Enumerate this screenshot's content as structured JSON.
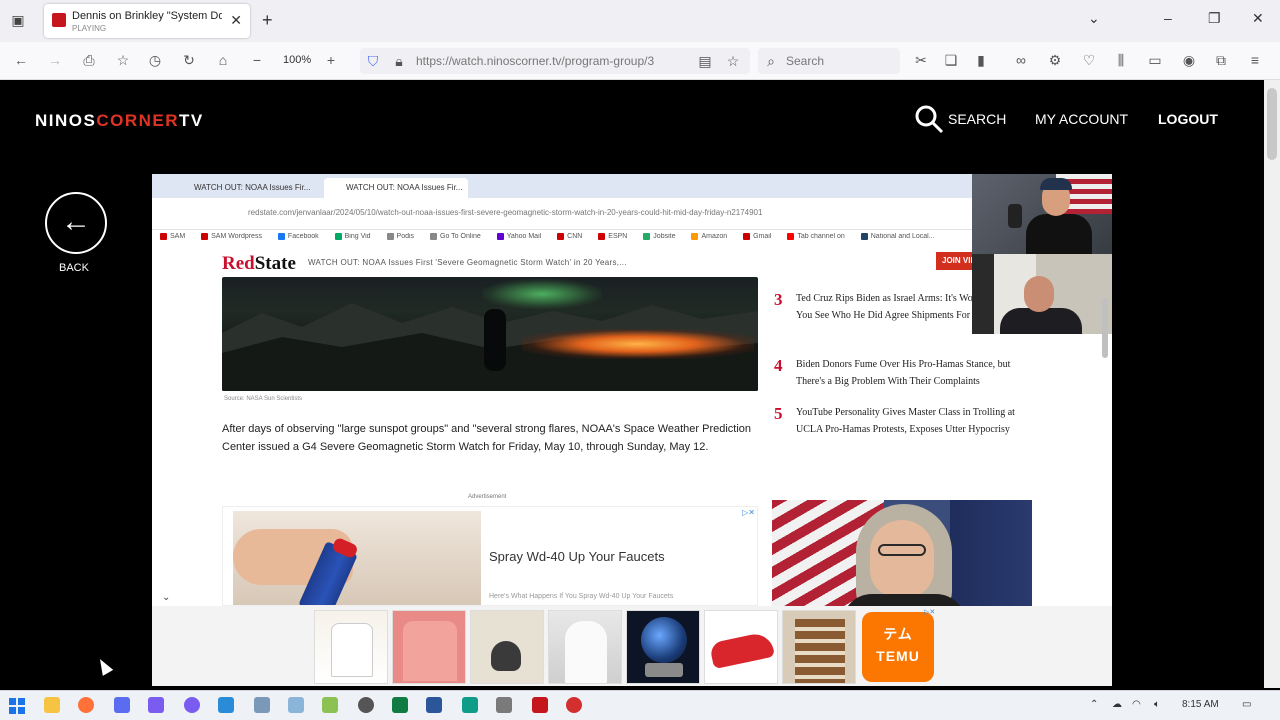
{
  "browser": {
    "tab": {
      "title": "Dennis on Brinkley \"System Dow",
      "subtitle": "PLAYING",
      "close": "✕"
    },
    "new_tab": "+",
    "zoom": "100%",
    "url": "https://watch.ninoscorner.tv/program-group/3",
    "search_placeholder": "Search"
  },
  "site": {
    "logo_part1": "NINOS",
    "logo_part2": "CORNER",
    "logo_part3": "TV",
    "search_label": "SEARCH",
    "account_label": "MY ACCOUNT",
    "logout_label": "LOGOUT",
    "back_label": "BACK",
    "back_arrow": "←"
  },
  "video": {
    "inner_tabs": [
      "WATCH OUT: NOAA Issues Fir...",
      "WATCH OUT: NOAA Issues Fir..."
    ],
    "inner_url": "redstate.com/jenvanlaar/2024/05/10/watch-out-noaa-issues-first-severe-geomagnetic-storm-watch-in-20-years-could-hit-mid-day-friday-n2174901",
    "bookmarks": [
      "SAM",
      "SAM Wordpress",
      "Facebook",
      "Bing Vid",
      "Podis",
      "Go To Online",
      "Yahoo Mail",
      "CNN",
      "ESPN",
      "Jobsite",
      "Amazon",
      "Gmail",
      "Tab channel on",
      "National and Local..."
    ],
    "redstate_red": "Red",
    "redstate_black": "State",
    "ticker": "WATCH OUT: NOAA Issues First 'Severe Geomagnetic Storm Watch' in 20 Years,...",
    "join": "JOIN VIP",
    "hero_caption": "Source: NASA Sun Scientists",
    "article": "After days of observing \"large sunspot groups\" and \"several strong flares, NOAA's Space Weather Prediction Center issued a G4 Severe Geomagnetic Storm Watch for Friday, May 10, through Sunday, May 12.",
    "advertisement_label": "Advertisement",
    "ad_title": "Spray Wd-40 Up Your Faucets",
    "ad_subtitle": "Here's What Happens If You Spray Wd-40 Up Your Faucets",
    "trending": [
      {
        "num": "3",
        "title": "Ted Cruz Rips Biden as Israel Arms: It's Worse When You See Who He Did Agree Shipments For"
      },
      {
        "num": "4",
        "title": "Biden Donors Fume Over His Pro-Hamas Stance, but There's a Big Problem With Their Complaints"
      },
      {
        "num": "5",
        "title": "YouTube Personality Gives Master Class in Trolling at UCLA Pro-Hamas Protests, Exposes Utter Hypocrisy"
      }
    ],
    "temu_label": "TEMU",
    "temu_jp": "テム",
    "ad_choice": "▷✕",
    "chevron": "⌄"
  },
  "taskbar": {
    "time": "8:15 AM"
  }
}
